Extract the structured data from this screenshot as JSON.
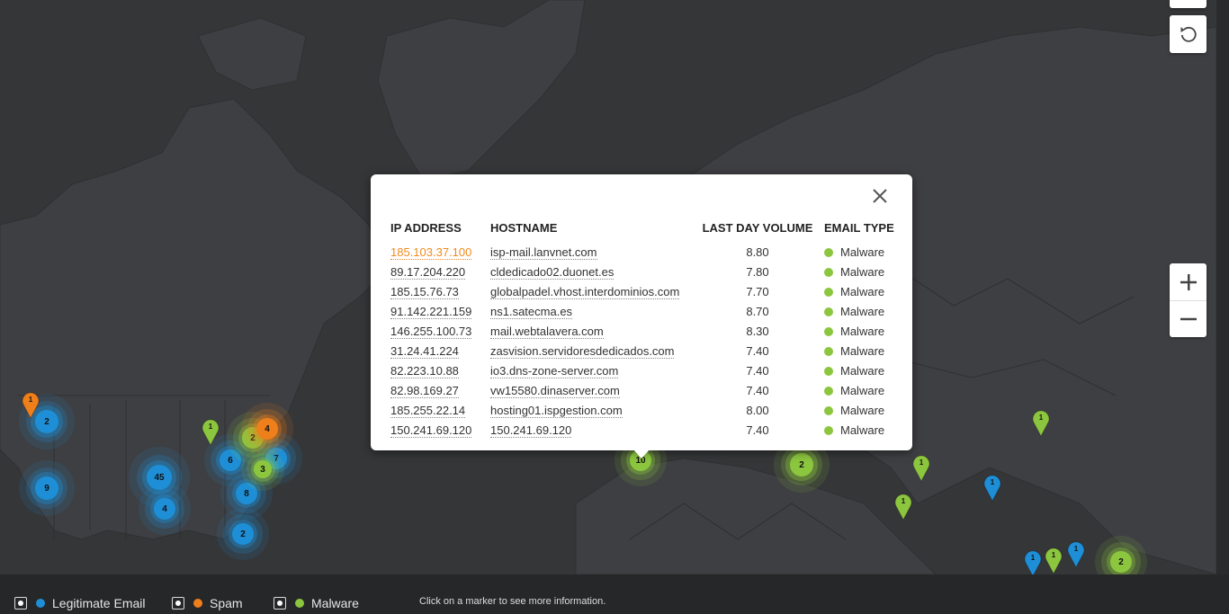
{
  "colors": {
    "legitimate": "#1e8fd6",
    "spam": "#ef7f1a",
    "malware": "#8cc63f",
    "active_link": "#f08a1e"
  },
  "controls": {
    "reset_icon": "reset-view-icon",
    "zoom_in_icon": "plus-icon",
    "zoom_out_icon": "minus-icon"
  },
  "markers": [
    {
      "kind": "cluster",
      "type": "legitimate",
      "count": "2"
    },
    {
      "kind": "cluster",
      "type": "legitimate",
      "count": "9"
    },
    {
      "kind": "cluster",
      "type": "legitimate",
      "count": "45"
    },
    {
      "kind": "cluster",
      "type": "legitimate",
      "count": "4"
    },
    {
      "kind": "cluster",
      "type": "legitimate",
      "count": "6"
    },
    {
      "kind": "cluster",
      "type": "legitimate",
      "count": "8"
    },
    {
      "kind": "cluster",
      "type": "legitimate",
      "count": "2"
    },
    {
      "kind": "cluster",
      "type": "legitimate",
      "count": "7"
    },
    {
      "kind": "cluster",
      "type": "malware",
      "count": "2"
    },
    {
      "kind": "cluster",
      "type": "malware",
      "count": "3"
    },
    {
      "kind": "cluster",
      "type": "spam",
      "count": "4"
    },
    {
      "kind": "cluster",
      "type": "malware",
      "count": "10"
    },
    {
      "kind": "cluster",
      "type": "malware",
      "count": "2"
    },
    {
      "kind": "cluster",
      "type": "malware",
      "count": "2"
    },
    {
      "kind": "pin",
      "type": "spam",
      "count": "1"
    },
    {
      "kind": "pin",
      "type": "malware",
      "count": "1"
    },
    {
      "kind": "pin",
      "type": "malware",
      "count": "1"
    },
    {
      "kind": "pin",
      "type": "malware",
      "count": "1"
    },
    {
      "kind": "pin",
      "type": "malware",
      "count": "1"
    },
    {
      "kind": "pin",
      "type": "legitimate",
      "count": "1"
    },
    {
      "kind": "pin",
      "type": "legitimate",
      "count": "1"
    },
    {
      "kind": "pin",
      "type": "malware",
      "count": "1"
    },
    {
      "kind": "pin",
      "type": "legitimate",
      "count": "1"
    }
  ],
  "popup": {
    "headers": {
      "ip": "IP ADDRESS",
      "host": "HOSTNAME",
      "volume": "LAST DAY VOLUME",
      "type": "EMAIL TYPE"
    },
    "rows": [
      {
        "ip": "185.103.37.100",
        "host": "isp-mail.lanvnet.com",
        "volume": "8.80",
        "type": "Malware"
      },
      {
        "ip": "89.17.204.220",
        "host": "cldedicado02.duonet.es",
        "volume": "7.80",
        "type": "Malware"
      },
      {
        "ip": "185.15.76.73",
        "host": "globalpadel.vhost.interdominios.com",
        "volume": "7.70",
        "type": "Malware"
      },
      {
        "ip": "91.142.221.159",
        "host": "ns1.satecma.es",
        "volume": "8.70",
        "type": "Malware"
      },
      {
        "ip": "146.255.100.73",
        "host": "mail.webtalavera.com",
        "volume": "8.30",
        "type": "Malware"
      },
      {
        "ip": "31.24.41.224",
        "host": "zasvision.servidoresdedicados.com",
        "volume": "7.40",
        "type": "Malware"
      },
      {
        "ip": "82.223.10.88",
        "host": "io3.dns-zone-server.com",
        "volume": "7.40",
        "type": "Malware"
      },
      {
        "ip": "82.98.169.27",
        "host": "vw15580.dinaserver.com",
        "volume": "7.40",
        "type": "Malware"
      },
      {
        "ip": "185.255.22.14",
        "host": "hosting01.ispgestion.com",
        "volume": "8.00",
        "type": "Malware"
      },
      {
        "ip": "150.241.69.120",
        "host": "150.241.69.120",
        "volume": "7.40",
        "type": "Malware"
      }
    ]
  },
  "legend": {
    "items": [
      {
        "label": "Legitimate Email",
        "type": "legitimate",
        "checked": true
      },
      {
        "label": "Spam",
        "type": "spam",
        "checked": true
      },
      {
        "label": "Malware",
        "type": "malware",
        "checked": true
      }
    ],
    "hint": "Click on a marker to see more information."
  }
}
